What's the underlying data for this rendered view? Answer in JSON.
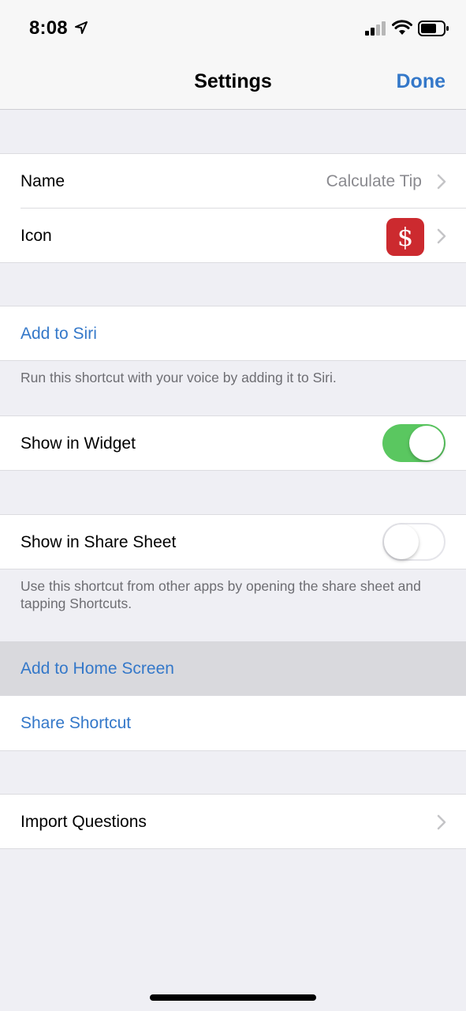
{
  "status_bar": {
    "time": "8:08",
    "icons": [
      "location-arrow-icon",
      "cellular-signal-icon",
      "wifi-icon",
      "battery-icon"
    ]
  },
  "nav": {
    "title": "Settings",
    "done_label": "Done"
  },
  "colors": {
    "accent": "#3478c9",
    "toggle_on": "#5ac760",
    "icon_red": "#cc2a2f",
    "background": "#efeff4"
  },
  "general": {
    "name_label": "Name",
    "name_value": "Calculate Tip",
    "icon_label": "Icon",
    "icon_glyph": "$"
  },
  "siri": {
    "label": "Add to Siri",
    "footer": "Run this shortcut with your voice by adding it to Siri."
  },
  "widget": {
    "label": "Show in Widget",
    "enabled": true
  },
  "share_sheet": {
    "label": "Show in Share Sheet",
    "enabled": false,
    "footer": "Use this shortcut from other apps by opening the share sheet and tapping Shortcuts."
  },
  "actions": {
    "home_screen_label": "Add to Home Screen",
    "share_label": "Share Shortcut"
  },
  "import": {
    "label": "Import Questions"
  }
}
